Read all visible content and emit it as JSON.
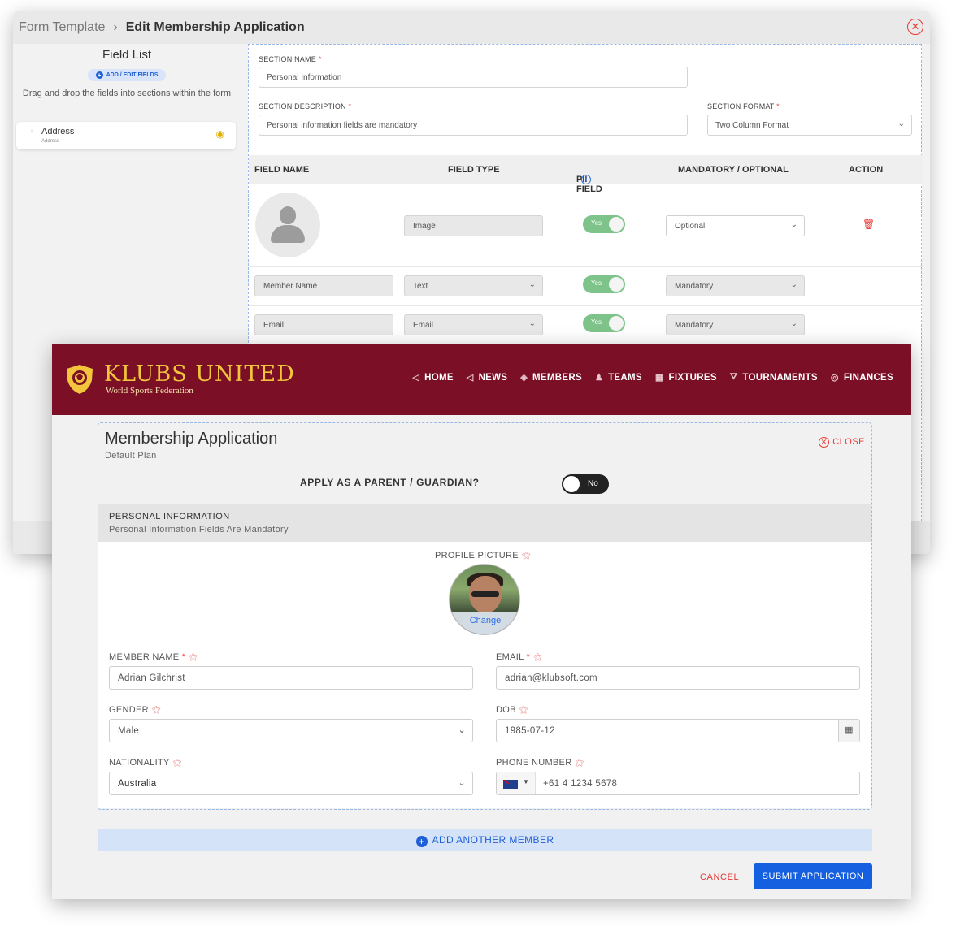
{
  "back": {
    "breadcrumb": {
      "parent": "Form Template",
      "current": "Edit Membership Application"
    },
    "field_list": {
      "title": "Field List",
      "add_button": "ADD / EDIT FIELDS",
      "help": "Drag and drop the fields into sections within the form",
      "items": [
        {
          "title": "Address",
          "subtitle": "Address"
        }
      ]
    },
    "section": {
      "name_label": "SECTION NAME",
      "name_value": "Personal Information",
      "desc_label": "SECTION DESCRIPTION",
      "desc_value": "Personal information fields are mandatory",
      "format_label": "SECTION FORMAT",
      "format_value": "Two Column Format"
    },
    "grid": {
      "headers": [
        "FIELD NAME",
        "FIELD TYPE",
        "PII FIELD",
        "MANDATORY / OPTIONAL",
        "ACTION"
      ],
      "rows": [
        {
          "name": "",
          "type": "Image",
          "pii": "Yes",
          "mode": "Optional"
        },
        {
          "name": "Member Name",
          "type": "Text",
          "pii": "Yes",
          "mode": "Mandatory"
        },
        {
          "name": "Email",
          "type": "Email",
          "pii": "Yes",
          "mode": "Mandatory"
        }
      ]
    }
  },
  "front": {
    "brand": {
      "name": "KLUBS UNITED",
      "sub": "World Sports Federation"
    },
    "nav": [
      "HOME",
      "NEWS",
      "MEMBERS",
      "TEAMS",
      "FIXTURES",
      "TOURNAMENTS",
      "FINANCES"
    ],
    "app": {
      "title": "Membership Application",
      "subtitle": "Default Plan",
      "close": "CLOSE",
      "parent_question": "APPLY AS A PARENT / GUARDIAN?",
      "parent_toggle": "No",
      "section_title": "PERSONAL INFORMATION",
      "section_sub": "Personal Information Fields Are Mandatory",
      "profile_label": "PROFILE PICTURE",
      "change": "Change",
      "fields": {
        "member_name_label": "MEMBER NAME",
        "member_name": "Adrian Gilchrist",
        "email_label": "EMAIL",
        "email": "adrian@klubsoft.com",
        "gender_label": "GENDER",
        "gender": "Male",
        "dob_label": "DOB",
        "dob": "1985-07-12",
        "nationality_label": "NATIONALITY",
        "nationality": "Australia",
        "phone_label": "PHONE NUMBER",
        "phone": "+61 4 1234 5678"
      }
    },
    "add_member": "ADD ANOTHER MEMBER",
    "cancel": "CANCEL",
    "submit": "SUBMIT APPLICATION"
  },
  "colors": {
    "brand": "#7a0f25",
    "accent": "#1460e0",
    "gold": "#f2c53d",
    "danger": "#e53935",
    "pii_green": "#7ec48a"
  }
}
